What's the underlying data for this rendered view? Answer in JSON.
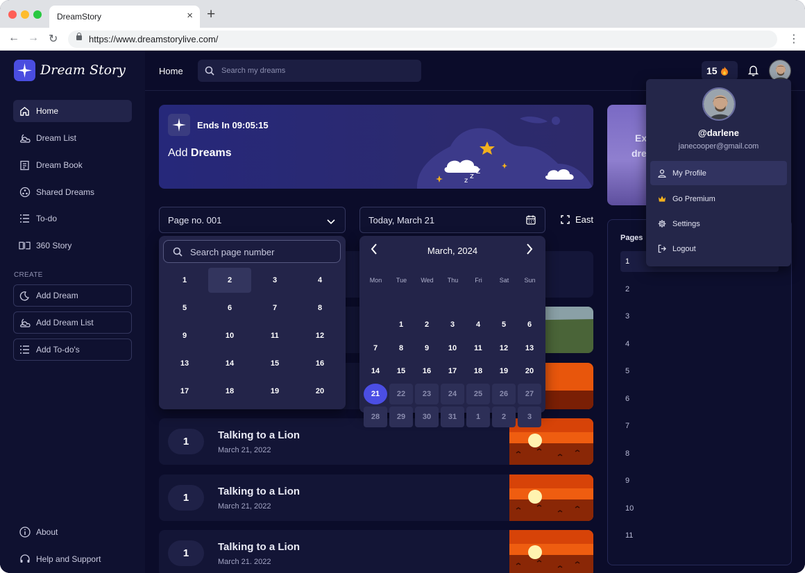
{
  "browser": {
    "tab_title": "DreamStory",
    "tab_close": "×",
    "new_tab": "+",
    "url": "https://www.dreamstorylive.com/",
    "back": "←",
    "forward": "→",
    "reload": "↻",
    "menu": "⋮"
  },
  "app": {
    "logo_text": "Dream Story",
    "header": {
      "home_link": "Home",
      "search_placeholder": "Search my dreams",
      "streak_count": "15",
      "streak_icon": "fire-icon"
    },
    "sidebar": {
      "items": [
        {
          "label": "Home",
          "icon": "home-icon",
          "active": true
        },
        {
          "label": "Dream List",
          "icon": "moon-cloud-icon"
        },
        {
          "label": "Dream Book",
          "icon": "book-icon"
        },
        {
          "label": "Shared Dreams",
          "icon": "share-icon"
        },
        {
          "label": "To-do",
          "icon": "list-icon"
        },
        {
          "label": "360 Story",
          "icon": "book-open-icon"
        }
      ],
      "create_label": "CREATE",
      "create_buttons": [
        {
          "label": "Add Dream",
          "icon": "moon-icon"
        },
        {
          "label": "Add Dream List",
          "icon": "moon-cloud-icon"
        },
        {
          "label": "Add To-do's",
          "icon": "list-icon"
        }
      ],
      "bottom": [
        {
          "label": "About",
          "icon": "info-icon"
        },
        {
          "label": "Help and Support",
          "icon": "headset-icon"
        }
      ]
    },
    "banner": {
      "ends_in": "Ends In 09:05:15",
      "title_plain": "Add",
      "title_bold": "Dreams"
    },
    "side_card": {
      "line1": "Ex",
      "line2": "dre"
    },
    "filters": {
      "page_select": "Page no. 001",
      "date_select": "Today, March 21",
      "east_label": "East"
    },
    "page_dropdown": {
      "search_placeholder": "Search page number",
      "numbers": [
        "1",
        "2",
        "3",
        "4",
        "5",
        "6",
        "7",
        "8",
        "9",
        "10",
        "11",
        "12",
        "13",
        "14",
        "15",
        "16",
        "17",
        "18",
        "19",
        "20"
      ],
      "selected": "2"
    },
    "calendar": {
      "month_label": "March, 2024",
      "weekdays": [
        "Mon",
        "Tue",
        "Wed",
        "Thu",
        "Fri",
        "Sat",
        "Sun"
      ],
      "weeks": [
        [
          "",
          "1",
          "2",
          "3",
          "4",
          "5",
          "6"
        ],
        [
          "7",
          "8",
          "9",
          "10",
          "11",
          "12",
          "13"
        ],
        [
          "14",
          "15",
          "16",
          "17",
          "18",
          "19",
          "20"
        ],
        [
          "21",
          "22",
          "23",
          "24",
          "25",
          "26",
          "27"
        ],
        [
          "28",
          "29",
          "30",
          "31",
          "1",
          "2",
          "3"
        ]
      ],
      "today": "21"
    },
    "dreams": [
      {
        "num": "1",
        "title": "Talking to a Lion",
        "date": "March 21, 2022"
      },
      {
        "num": "1",
        "title": "Talking to a Lion",
        "date": "March 21, 2022"
      },
      {
        "num": "1",
        "title": "Talking to a Lion",
        "date": "March 21. 2022"
      }
    ],
    "pages_panel": {
      "title": "Pages",
      "items": [
        "1",
        "2",
        "3",
        "4",
        "5",
        "6",
        "7",
        "8",
        "9",
        "10",
        "11"
      ]
    },
    "profile_menu": {
      "handle": "@darlene",
      "email": "janecooper@gmail.com",
      "items": [
        {
          "label": "My Profile",
          "icon": "user-icon"
        },
        {
          "label": "Go Premium",
          "icon": "crown-icon"
        },
        {
          "label": "Settings",
          "icon": "gear-icon"
        },
        {
          "label": "Logout",
          "icon": "logout-icon"
        }
      ]
    },
    "colors": {
      "background": "#0b0c2a",
      "sidebar": "#0f1130",
      "accent": "#4b4ee4",
      "panel": "#232449"
    }
  }
}
